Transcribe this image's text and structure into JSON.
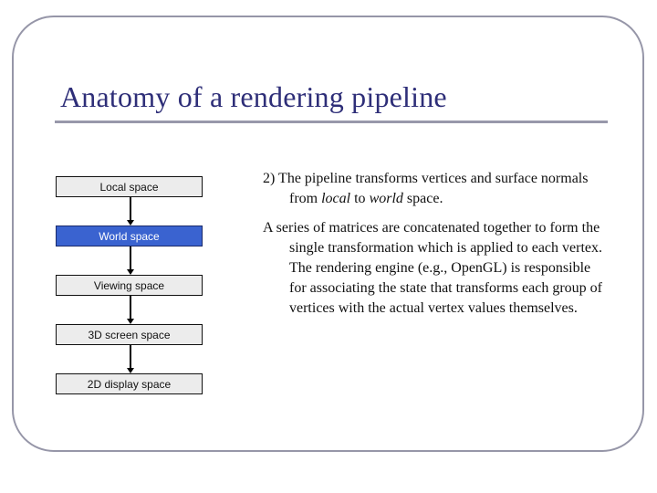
{
  "slide": {
    "title": "Anatomy of a rendering pipeline",
    "colors": {
      "title": "#2e2e78",
      "frame": "#9696a8",
      "box_fill": "#ececec",
      "box_active_fill": "#3a63d0"
    },
    "pipeline": {
      "stages": [
        {
          "label": "Local space",
          "active": false
        },
        {
          "label": "World space",
          "active": true
        },
        {
          "label": "Viewing space",
          "active": false
        },
        {
          "label": "3D screen space",
          "active": false
        },
        {
          "label": "2D display space",
          "active": false
        }
      ]
    },
    "body": {
      "p1_part1": "2) The pipeline transforms vertices and surface normals from ",
      "p1_em1": "local",
      "p1_part2": " to ",
      "p1_em2": "world",
      "p1_part3": " space.",
      "p2": "A series of matrices are concatenated together to form the single transformation which is applied to each vertex.  The rendering engine (e.g., OpenGL) is responsible for associating the state that transforms each group of vertices with the actual vertex values themselves."
    }
  }
}
